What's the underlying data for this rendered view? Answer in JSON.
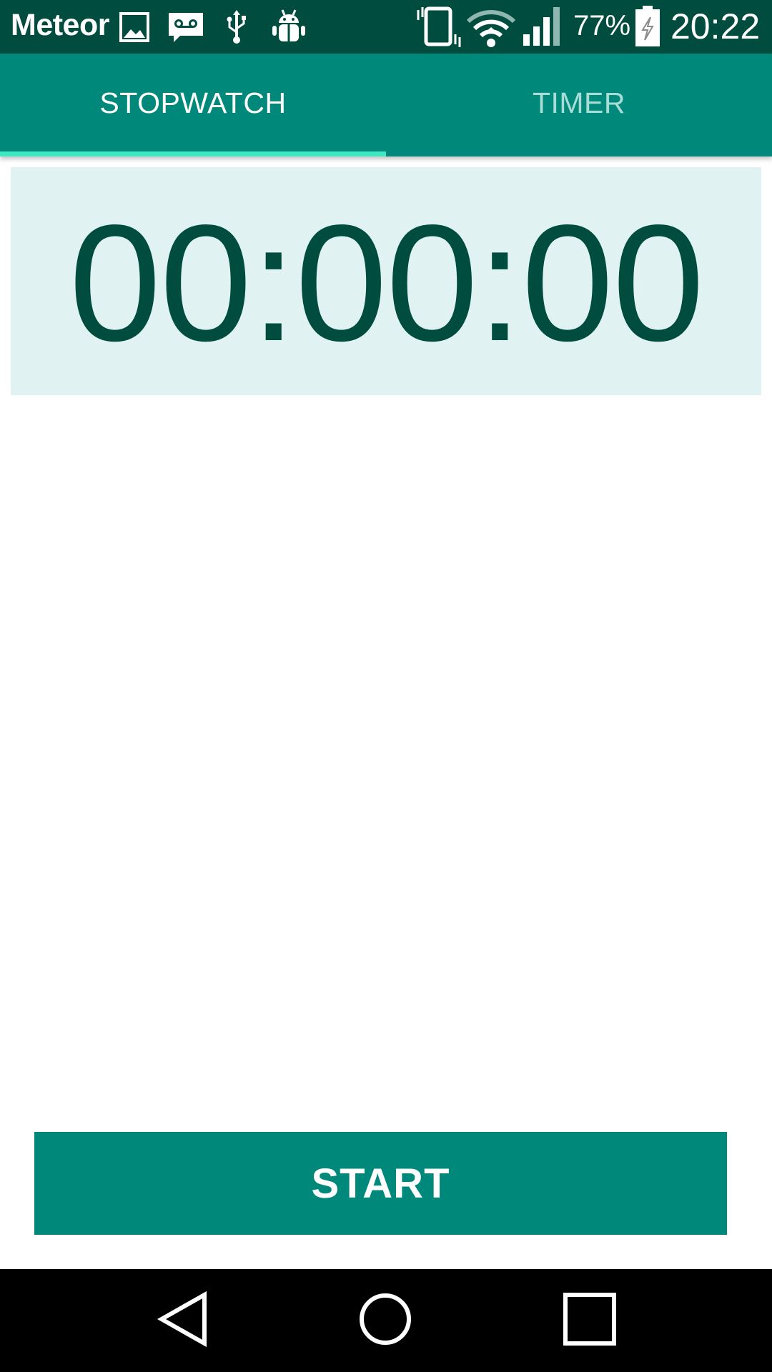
{
  "status_bar": {
    "carrier": "Meteor",
    "battery_percent": "77%",
    "time": "20:22",
    "icons": [
      "image-icon",
      "voicemail-icon",
      "usb-icon",
      "android-debug-icon",
      "vibrate-icon",
      "wifi-icon",
      "signal-icon",
      "battery-icon"
    ]
  },
  "tabs": [
    {
      "label": "STOPWATCH",
      "selected": true
    },
    {
      "label": "TIMER",
      "selected": false
    }
  ],
  "stopwatch": {
    "time": "00:00:00"
  },
  "start_button": {
    "label": "START"
  },
  "nav_bar": {
    "icons": [
      "back-icon",
      "home-icon",
      "recents-icon"
    ]
  },
  "colors": {
    "primary": "#00897b",
    "primary_dark": "#004d40",
    "tab_indicator": "#3de8c3",
    "panel_bg": "#e0f2f1",
    "time_text": "#004d40"
  }
}
